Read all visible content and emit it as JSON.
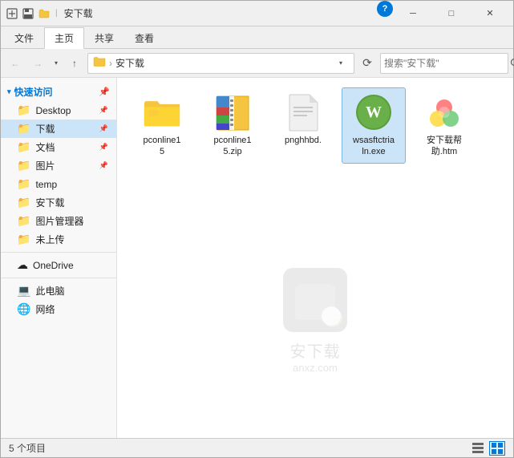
{
  "window": {
    "title": "安下载",
    "icons": [
      "new-icon",
      "save-icon",
      "folder-icon-title"
    ]
  },
  "titlebar": {
    "title": "安下载",
    "minimize_label": "─",
    "maximize_label": "□",
    "close_label": "✕",
    "info_label": "?"
  },
  "ribbon": {
    "tabs": [
      "文件",
      "主页",
      "共享",
      "查看"
    ],
    "active_tab": "主页"
  },
  "toolbar": {
    "back_label": "←",
    "forward_label": "→",
    "up_label": "↑",
    "breadcrumb_folder": "安下载",
    "breadcrumb_separator": "›",
    "address_text": "安下载",
    "refresh_label": "⟳",
    "search_placeholder": "搜索\"安下载\"",
    "search_icon_label": "🔍"
  },
  "sidebar": {
    "quick_access_label": "快速访问",
    "items": [
      {
        "id": "desktop",
        "label": "Desktop",
        "icon": "📁",
        "pinned": true
      },
      {
        "id": "downloads",
        "label": "下载",
        "icon": "📁",
        "pinned": true,
        "active": true
      },
      {
        "id": "documents",
        "label": "文档",
        "icon": "📁",
        "pinned": true
      },
      {
        "id": "pictures",
        "label": "图片",
        "icon": "📁",
        "pinned": true
      },
      {
        "id": "temp",
        "label": "temp",
        "icon": "📁"
      },
      {
        "id": "anxiazai",
        "label": "安下载",
        "icon": "📁"
      },
      {
        "id": "picmanager",
        "label": "图片管理器",
        "icon": "📁"
      },
      {
        "id": "notupload",
        "label": "未上传",
        "icon": "📁"
      }
    ],
    "onedrive_label": "OneDrive",
    "computer_label": "此电脑",
    "network_label": "网络"
  },
  "files": [
    {
      "id": "file1",
      "name": "pconline15",
      "type": "folder",
      "label": "pconline1\n5"
    },
    {
      "id": "file2",
      "name": "pconline15.zip",
      "type": "zip",
      "label": "pconline1\n5.zip"
    },
    {
      "id": "file3",
      "name": "pnghhbd.",
      "type": "document",
      "label": "pnghhbd."
    },
    {
      "id": "file4",
      "name": "wsasftctrialn.exe",
      "type": "exe",
      "label": "wsasftctria\nln.exe",
      "selected": true
    },
    {
      "id": "file5",
      "name": "安下载帮助.htm",
      "type": "htm",
      "label": "安下载帮\n助.htm"
    }
  ],
  "watermark": {
    "text": "安下载",
    "subtext": "anxz.com"
  },
  "statusbar": {
    "count_text": "5 个项目",
    "selected_text": ""
  }
}
